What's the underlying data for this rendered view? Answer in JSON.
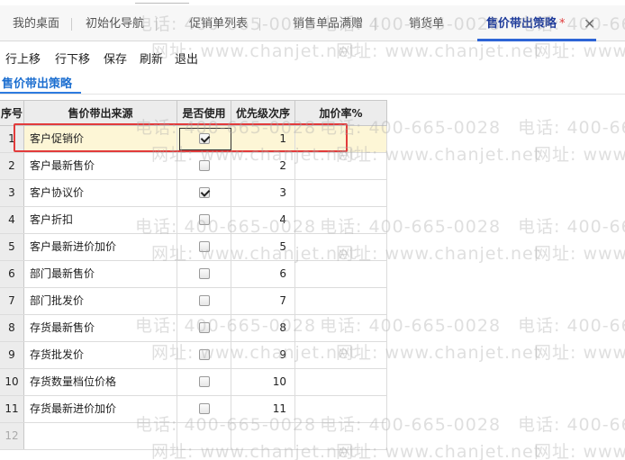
{
  "tabs": [
    {
      "label": "我的桌面"
    },
    {
      "label": "初始化导航"
    },
    {
      "label": "促销单列表"
    },
    {
      "label": "销售单品满赠"
    },
    {
      "label": "销货单"
    },
    {
      "label": "售价带出策略",
      "modified_mark": "*",
      "close": "✕"
    }
  ],
  "toolbar": {
    "move_up": "行上移",
    "move_down": "行下移",
    "save": "保存",
    "refresh": "刷新",
    "exit": "退出"
  },
  "section_title": "售价带出策略",
  "grid": {
    "headers": {
      "no": "序号",
      "source": "售价带出来源",
      "use": "是否使用",
      "priority": "优先级次序",
      "rate": "加价率%"
    },
    "rows": [
      {
        "no": "1",
        "source": "客户促销价",
        "use": true,
        "priority": "1"
      },
      {
        "no": "2",
        "source": "客户最新售价",
        "use": false,
        "priority": "2"
      },
      {
        "no": "3",
        "source": "客户协议价",
        "use": true,
        "priority": "3"
      },
      {
        "no": "4",
        "source": "客户折扣",
        "use": false,
        "priority": "4"
      },
      {
        "no": "5",
        "source": "客户最新进价加价",
        "use": false,
        "priority": "5"
      },
      {
        "no": "6",
        "source": "部门最新售价",
        "use": false,
        "priority": "6"
      },
      {
        "no": "7",
        "source": "部门批发价",
        "use": false,
        "priority": "7"
      },
      {
        "no": "8",
        "source": "存货最新售价",
        "use": false,
        "priority": "8"
      },
      {
        "no": "9",
        "source": "存货批发价",
        "use": false,
        "priority": "9"
      },
      {
        "no": "10",
        "source": "存货数量档位价格",
        "use": false,
        "priority": "10"
      },
      {
        "no": "11",
        "source": "存货最新进价加价",
        "use": false,
        "priority": "11"
      },
      {
        "no": "12",
        "source": "",
        "use": null,
        "priority": ""
      }
    ]
  },
  "watermark": {
    "phone": "电话: 400-665-0028",
    "site": "网址: www.chanjet.net"
  }
}
